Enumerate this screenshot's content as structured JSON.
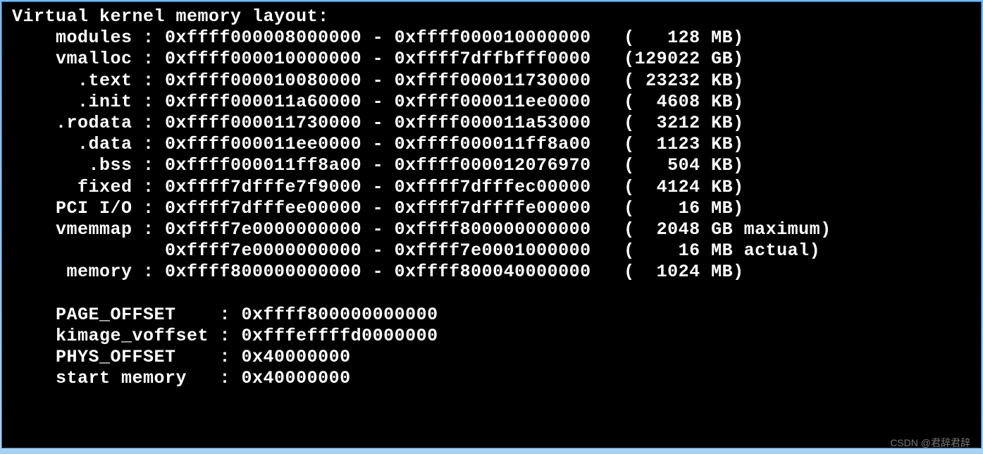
{
  "title": "Virtual kernel memory layout:",
  "rows": [
    {
      "label": "modules",
      "start": "0xffff000008000000",
      "end": "0xffff000010000000",
      "size": "128",
      "unit": "MB",
      "suffix": ""
    },
    {
      "label": "vmalloc",
      "start": "0xffff000010000000",
      "end": "0xffff7dffbfff0000",
      "size": "129022",
      "unit": "GB",
      "suffix": ""
    },
    {
      "label": ".text",
      "start": "0xffff000010080000",
      "end": "0xffff000011730000",
      "size": "23232",
      "unit": "KB",
      "suffix": ""
    },
    {
      "label": ".init",
      "start": "0xffff000011a60000",
      "end": "0xffff000011ee0000",
      "size": "4608",
      "unit": "KB",
      "suffix": ""
    },
    {
      "label": ".rodata",
      "start": "0xffff000011730000",
      "end": "0xffff000011a53000",
      "size": "3212",
      "unit": "KB",
      "suffix": ""
    },
    {
      "label": ".data",
      "start": "0xffff000011ee0000",
      "end": "0xffff000011ff8a00",
      "size": "1123",
      "unit": "KB",
      "suffix": ""
    },
    {
      "label": ".bss",
      "start": "0xffff000011ff8a00",
      "end": "0xffff000012076970",
      "size": "504",
      "unit": "KB",
      "suffix": ""
    },
    {
      "label": "fixed",
      "start": "0xffff7dfffe7f9000",
      "end": "0xffff7dfffec00000",
      "size": "4124",
      "unit": "KB",
      "suffix": ""
    },
    {
      "label": "PCI I/O",
      "start": "0xffff7dfffee00000",
      "end": "0xffff7dffffe00000",
      "size": "16",
      "unit": "MB",
      "suffix": ""
    },
    {
      "label": "vmemmap",
      "start": "0xffff7e0000000000",
      "end": "0xffff800000000000",
      "size": "2048",
      "unit": "GB",
      "suffix": " maximum"
    },
    {
      "label": "",
      "start": "0xffff7e0000000000",
      "end": "0xffff7e0001000000",
      "size": "16",
      "unit": "MB",
      "suffix": " actual"
    },
    {
      "label": "memory",
      "start": "0xffff800000000000",
      "end": "0xffff800040000000",
      "size": "1024",
      "unit": "MB",
      "suffix": ""
    }
  ],
  "offsets": [
    {
      "label": "PAGE_OFFSET",
      "value": "0xffff800000000000"
    },
    {
      "label": "kimage_voffset",
      "value": "0xfffeffffd0000000"
    },
    {
      "label": "PHYS_OFFSET",
      "value": "0x40000000"
    },
    {
      "label": "start memory",
      "value": "0x40000000"
    }
  ],
  "watermark": "CSDN @君辞君辞"
}
